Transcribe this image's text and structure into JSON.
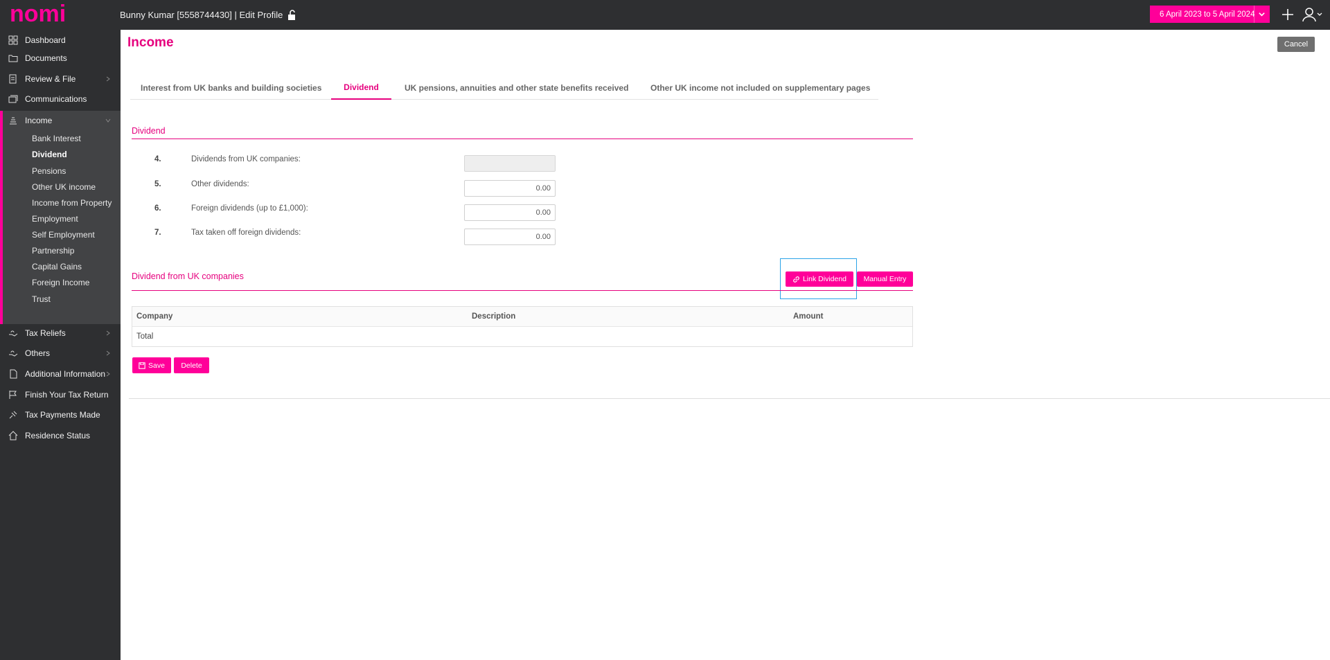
{
  "header": {
    "logo_text": "nomi",
    "profile_title": "Bunny Kumar [5558744430] | Edit Profile",
    "date_range": "6 April 2023 to 5 April 2024",
    "accent_color": "#ff0099"
  },
  "sidebar": {
    "items": [
      {
        "label": "Dashboard",
        "icon": "dashboard-icon"
      },
      {
        "label": "Documents",
        "icon": "folder-icon"
      },
      {
        "label": "Review & File",
        "icon": "review-icon"
      },
      {
        "label": "Communications",
        "icon": "messages-icon"
      },
      {
        "label": "Income",
        "icon": "income-icon"
      },
      {
        "label": "Tax Reliefs",
        "icon": "hand-icon"
      },
      {
        "label": "Others",
        "icon": "hand-icon"
      },
      {
        "label": "Additional Information",
        "icon": "document-icon"
      },
      {
        "label": "Finish Your Tax Return",
        "icon": "flag-icon"
      },
      {
        "label": "Tax Payments Made",
        "icon": "pin-icon"
      },
      {
        "label": "Residence Status",
        "icon": "home-icon"
      }
    ],
    "income_sub_items": [
      "Bank Interest",
      "Dividend",
      "Pensions",
      "Other UK income",
      "Income from Property",
      "Employment",
      "Self Employment",
      "Partnership",
      "Capital Gains",
      "Foreign Income",
      "Trust"
    ],
    "active_sub_item": "Dividend"
  },
  "main": {
    "title": "Income",
    "cancel_label": "Cancel",
    "tabs": [
      {
        "label": "Interest from UK banks and building societies"
      },
      {
        "label": "Dividend"
      },
      {
        "label": "UK pensions, annuities and other state benefits received"
      },
      {
        "label": "Other UK income not included on supplementary pages"
      }
    ],
    "active_tab": "Dividend",
    "dividend_section": {
      "title": "Dividend",
      "rows": [
        {
          "num": "4.",
          "label": "Dividends from UK companies:",
          "value": ""
        },
        {
          "num": "5.",
          "label": "Other dividends:",
          "value": "0.00"
        },
        {
          "num": "6.",
          "label": "Foreign dividends (up to £1,000):",
          "value": "0.00"
        },
        {
          "num": "7.",
          "label": "Tax taken off foreign dividends:",
          "value": "0.00"
        }
      ]
    },
    "uk_companies_section": {
      "title": "Dividend from UK companies",
      "link_label": "Link Dividend",
      "manual_label": "Manual Entry",
      "columns": [
        "Company",
        "Description",
        "Amount"
      ],
      "total_label": "Total"
    },
    "save_label": "Save",
    "delete_label": "Delete"
  }
}
